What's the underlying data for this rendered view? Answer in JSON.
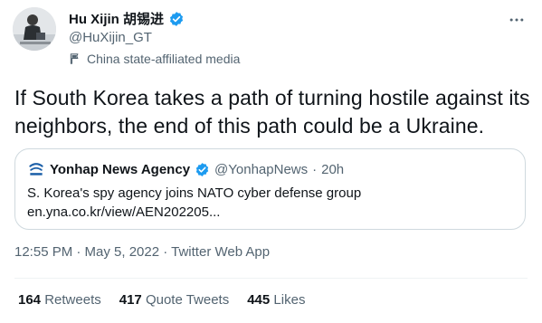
{
  "author": {
    "name": "Hu Xijin 胡锡进",
    "handle": "@HuXijin_GT",
    "label": "China state-affiliated media",
    "verified_color": "#1d9bf0"
  },
  "tweet": {
    "text": "If South Korea takes a path of turning hostile against its neighbors, the end of this path could be a Ukraine."
  },
  "quote": {
    "name": "Yonhap News Agency",
    "handle": "@YonhapNews",
    "separator": "·",
    "time": "20h",
    "text_line1": "S. Korea's spy agency joins NATO cyber defense group",
    "text_line2": "en.yna.co.kr/view/AEN202205..."
  },
  "meta": {
    "timestamp": "12:55 PM · May 5, 2022 · Twitter Web App"
  },
  "stats": {
    "retweets_count": "164",
    "retweets_label": "Retweets",
    "quotes_count": "417",
    "quotes_label": "Quote Tweets",
    "likes_count": "445",
    "likes_label": "Likes"
  },
  "icons": [
    "more-icon",
    "verified-badge-icon",
    "state-media-flag-icon",
    "yonhap-logo-icon"
  ]
}
